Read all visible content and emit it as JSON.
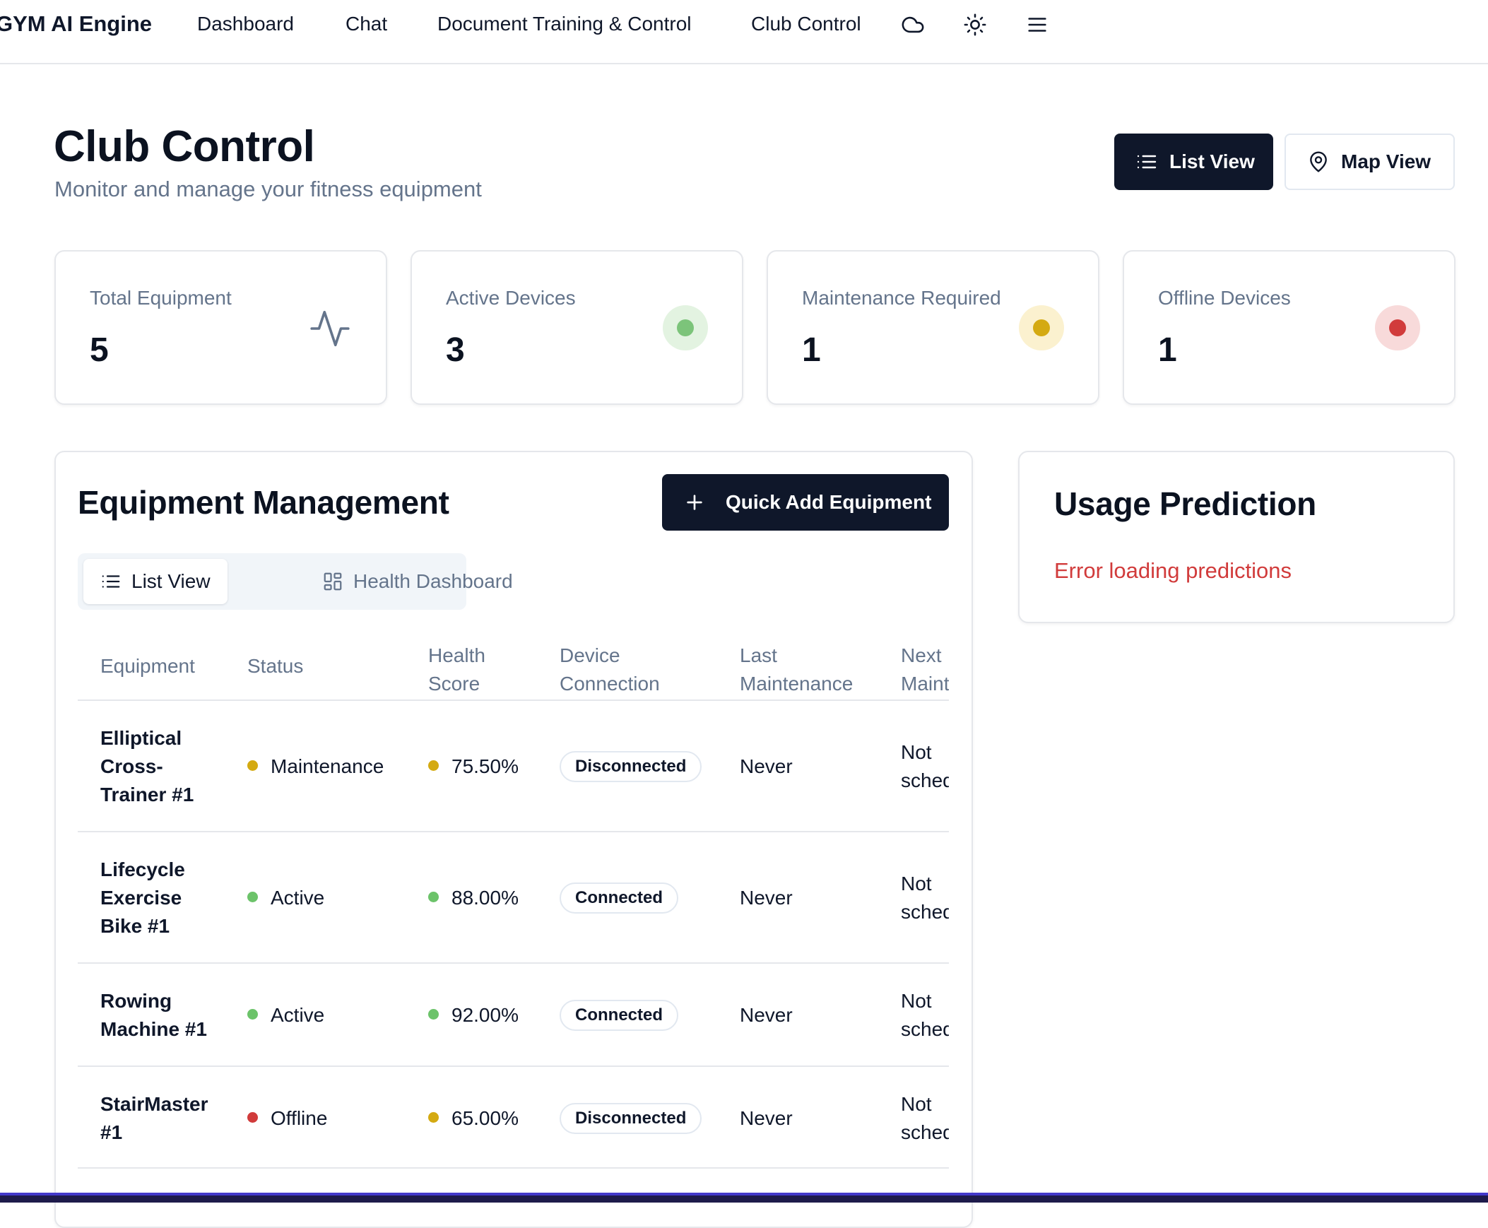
{
  "nav": {
    "brand": "GYM AI Engine",
    "links": [
      "Dashboard",
      "Chat",
      "Document Training & Control",
      "Club Control"
    ],
    "icons": [
      "cloud-icon",
      "sun-icon",
      "menu-icon"
    ]
  },
  "header": {
    "title": "Club Control",
    "subtitle": "Monitor and manage your fitness equipment",
    "list_view_label": "List View",
    "map_view_label": "Map View"
  },
  "stats": [
    {
      "label": "Total Equipment",
      "value": "5",
      "icon": "activity-icon"
    },
    {
      "label": "Active Devices",
      "value": "3",
      "indicator_color": "#7cc47a",
      "indicator_bg": "#e3f3e1"
    },
    {
      "label": "Maintenance Required",
      "value": "1",
      "indicator_color": "#d4aa12",
      "indicator_bg": "#fbf1cf"
    },
    {
      "label": "Offline Devices",
      "value": "1",
      "indicator_color": "#d13b3b",
      "indicator_bg": "#f8dada"
    }
  ],
  "equipment": {
    "title": "Equipment Management",
    "quick_add_label": "Quick Add Equipment",
    "tabs": {
      "list": "List View",
      "health": "Health Dashboard"
    },
    "columns": [
      [
        "Equipment",
        ""
      ],
      [
        "Status",
        ""
      ],
      [
        "Health",
        "Score"
      ],
      [
        "Device",
        "Connection"
      ],
      [
        "Last",
        "Maintenance"
      ],
      [
        "Next",
        "Maint"
      ]
    ],
    "rows": [
      {
        "name": [
          "Elliptical",
          "Cross-",
          "Trainer #1"
        ],
        "status": "Maintenance",
        "status_color": "#d4aa12",
        "health": "75.50%",
        "health_color": "#d4aa12",
        "connection": "Disconnected",
        "last": "Never",
        "next": [
          "Not",
          "sched"
        ]
      },
      {
        "name": [
          "Lifecycle",
          "Exercise",
          "Bike #1"
        ],
        "status": "Active",
        "status_color": "#6cc36a",
        "health": "88.00%",
        "health_color": "#6cc36a",
        "connection": "Connected",
        "last": "Never",
        "next": [
          "Not",
          "sched"
        ]
      },
      {
        "name": [
          "Rowing",
          "Machine #1"
        ],
        "status": "Active",
        "status_color": "#6cc36a",
        "health": "92.00%",
        "health_color": "#6cc36a",
        "connection": "Connected",
        "last": "Never",
        "next": [
          "Not",
          "sched"
        ]
      },
      {
        "name": [
          "StairMaster",
          "#1"
        ],
        "status": "Offline",
        "status_color": "#d13b3b",
        "health": "65.00%",
        "health_color": "#d4aa12",
        "connection": "Disconnected",
        "last": "Never",
        "next": [
          "Not",
          "sched"
        ]
      }
    ]
  },
  "prediction": {
    "title": "Usage Prediction",
    "error": "Error loading predictions",
    "error_color": "#d13b3b"
  }
}
